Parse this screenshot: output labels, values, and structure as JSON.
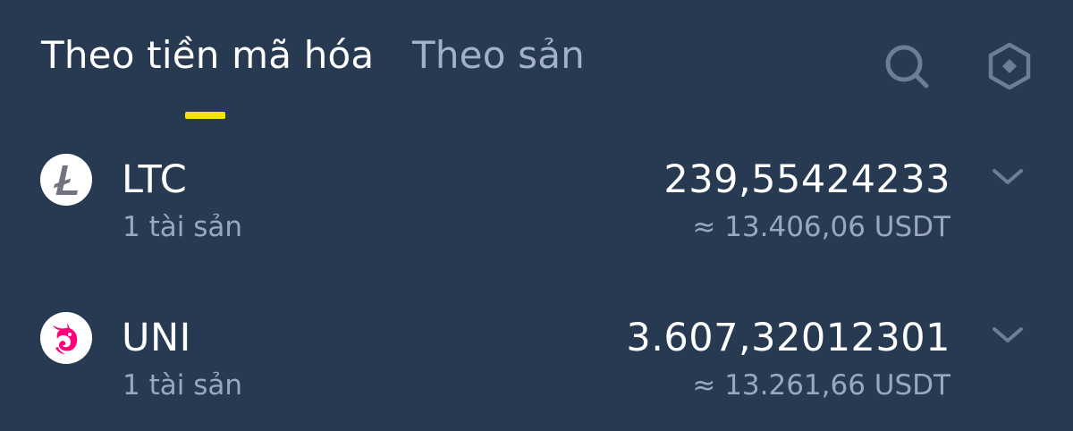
{
  "tabs": [
    {
      "label": "Theo tiền mã hóa",
      "active": true
    },
    {
      "label": "Theo sản",
      "active": false
    }
  ],
  "icons": {
    "search": "search-icon",
    "settings": "hexagon-settings-icon",
    "expand": "chevron-down-icon"
  },
  "colors": {
    "background": "#273a52",
    "accent": "#f6e30b",
    "muted_text": "#9aa7bd",
    "uni_brand": "#ff007a"
  },
  "assets": [
    {
      "symbol": "LTC",
      "sub": "1 tài sản",
      "amount": "239,55424233",
      "value": "≈ 13.406,06 USDT",
      "icon": "litecoin-logo-icon"
    },
    {
      "symbol": "UNI",
      "sub": "1 tài sản",
      "amount": "3.607,32012301",
      "value": "≈ 13.261,66 USDT",
      "icon": "uniswap-unicorn-logo-icon"
    }
  ]
}
